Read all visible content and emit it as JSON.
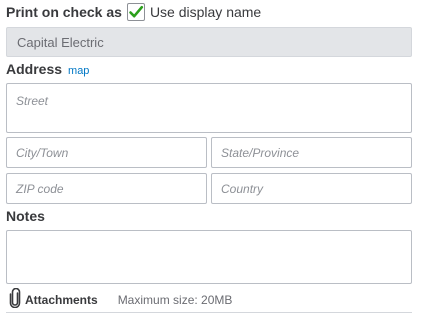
{
  "print_on_check": {
    "label": "Print on check as",
    "use_display_name_checked": true,
    "use_display_name_label": "Use display name",
    "display_name_value": "Capital Electric",
    "check_color": "#2ca01c"
  },
  "address": {
    "label": "Address",
    "map_link": "map",
    "street_placeholder": "Street",
    "city_placeholder": "City/Town",
    "state_placeholder": "State/Province",
    "zip_placeholder": "ZIP code",
    "country_placeholder": "Country"
  },
  "notes": {
    "label": "Notes",
    "value": ""
  },
  "attachments": {
    "icon": "paperclip-icon",
    "label": "Attachments",
    "max_size": "Maximum size: 20MB"
  },
  "colors": {
    "link": "#0077c5",
    "disabled_field_bg": "#e3e5e8",
    "border": "#babec5"
  }
}
